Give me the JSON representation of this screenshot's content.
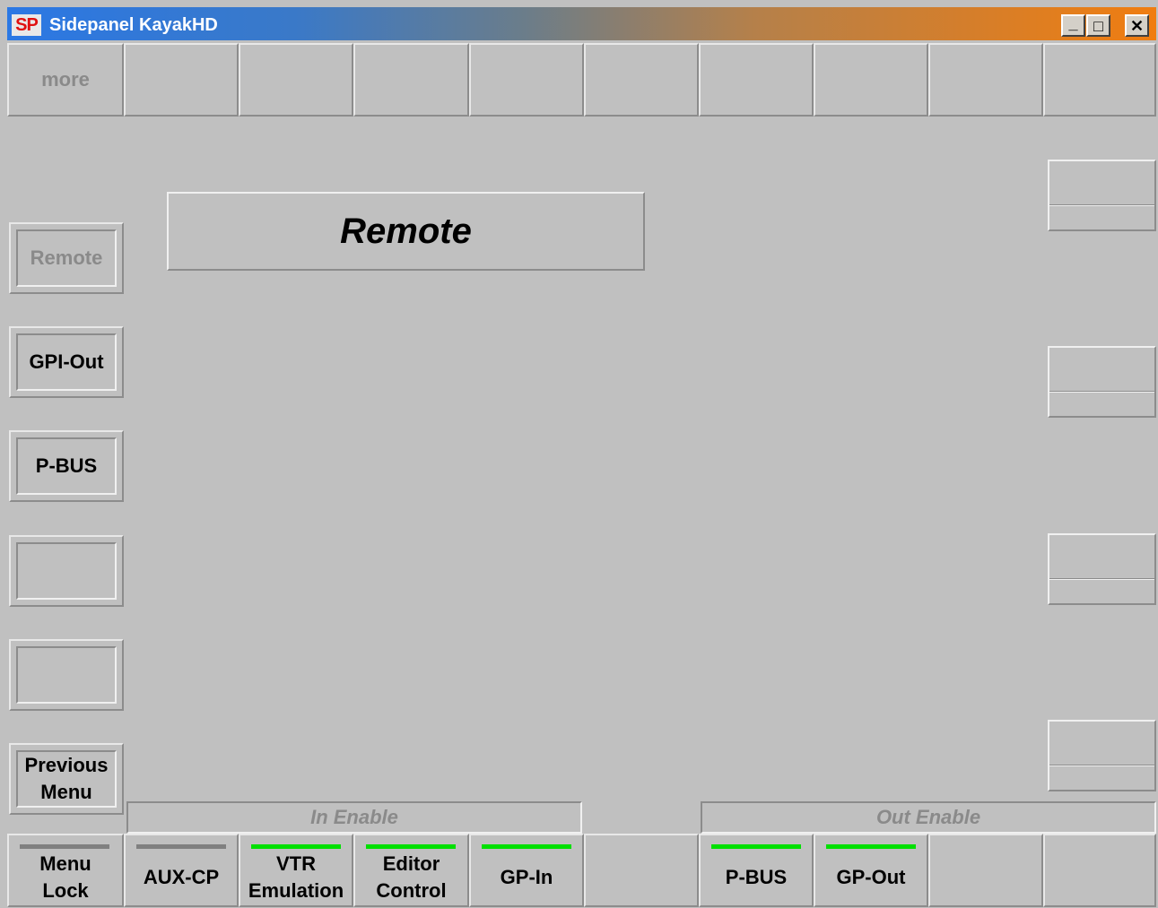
{
  "window": {
    "logo": "SP",
    "title": "Sidepanel KayakHD",
    "min_glyph": "_",
    "max_glyph": "□",
    "close_glyph": "✕"
  },
  "top_row": {
    "more_label": "more"
  },
  "left_menu": {
    "remote": "Remote",
    "gpi_out": "GPI-Out",
    "p_bus": "P-BUS",
    "empty1": "",
    "empty2": "",
    "previous_menu": "Previous\nMenu"
  },
  "main": {
    "title": "Remote"
  },
  "enable_labels": {
    "in": "In Enable",
    "out": "Out Enable"
  },
  "bottom_row": {
    "menu_lock": "Menu\nLock",
    "aux_cp": "AUX-CP",
    "vtr_emulation": "VTR\nEmulation",
    "editor_control": "Editor\nControl",
    "gp_in": "GP-In",
    "p_bus": "P-BUS",
    "gp_out": "GP-Out"
  },
  "colors": {
    "led_on": "#00e000",
    "led_off": "#808080",
    "panel": "#c0c0c0"
  }
}
